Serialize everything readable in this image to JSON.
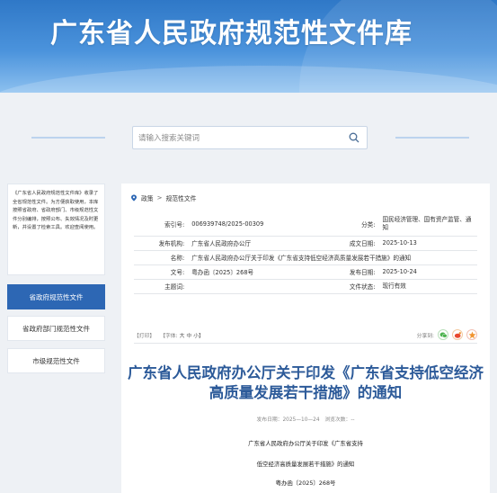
{
  "banner": {
    "title": "广东省人民政府规范性文件库"
  },
  "search": {
    "placeholder": "请输入搜索关键词"
  },
  "sidebar": {
    "intro": "《广东省人民政府规范性文件库》收录了全省规范性文件。为方便获取使用，本库按照省政府、省政府部门、市级规范性文件分别编排，按照公布、失效情况及时更新，并设置了检索工具。欢迎查阅使用。",
    "items": [
      {
        "label": "省政府规范性文件",
        "active": true
      },
      {
        "label": "省政府部门规范性文件",
        "active": false
      },
      {
        "label": "市级规范性文件",
        "active": false
      }
    ]
  },
  "breadcrumb": {
    "items": [
      "政策",
      "规范性文件"
    ],
    "sep": ">"
  },
  "meta": {
    "index_label": "索引号:",
    "index_value": "006939748/2025-00309",
    "category_label": "分类:",
    "category_value": "国民经济管理、国有资产监管、通知",
    "publisher_label": "发布机构:",
    "publisher_value": "广东省人民政府办公厅",
    "created_label": "成文日期:",
    "created_value": "2025-10-13",
    "name_label": "名称:",
    "name_value": "广东省人民政府办公厅关于印发《广东省支持低空经济高质量发展若干措施》的通知",
    "docno_label": "文号:",
    "docno_value": "粤办函〔2025〕268号",
    "pubdate_label": "发布日期:",
    "pubdate_value": "2025-10-24",
    "subject_label": "主题词:",
    "subject_value": "",
    "status_label": "文件状态:",
    "status_value": "现行有效"
  },
  "toolbar": {
    "print": "【打印】",
    "font": "【字体:",
    "large": "大",
    "medium": "中",
    "small": "小】",
    "share": "分享到:"
  },
  "document": {
    "title": "广东省人民政府办公厅关于印发《广东省支持低空经济高质量发展若干措施》的通知",
    "meta_line": "发布日期：2025—10—24　浏览次数：--",
    "body_line1": "广东省人民政府办公厅关于印发《广东省支持",
    "body_line2": "低空经济高质量发展若干措施》的通知",
    "body_line3": "粤办函〔2025〕268号"
  },
  "colors": {
    "banner": "#3b86d4",
    "accent": "#2d67b4",
    "title": "#2c5a99",
    "wechat": "#4cb34f",
    "weibo": "#f0932f"
  }
}
